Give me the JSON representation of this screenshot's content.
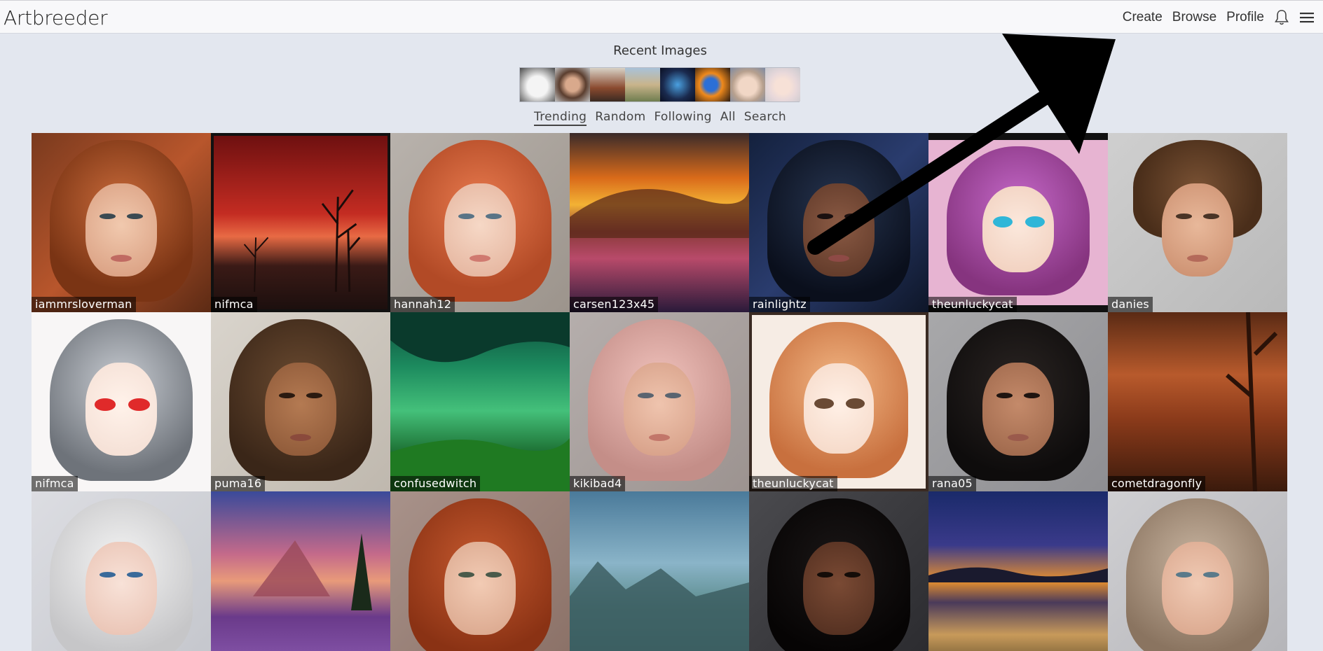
{
  "brand": "Artbreeder",
  "nav": {
    "create": "Create",
    "browse": "Browse",
    "profile": "Profile"
  },
  "recent": {
    "title": "Recent Images"
  },
  "tabs": [
    "Trending",
    "Random",
    "Following",
    "All",
    "Search"
  ],
  "grid": {
    "usernames": [
      "iammrsloverman",
      "nifmca",
      "hannah12",
      "carsen123x45",
      "rainlightz",
      "theunluckycat",
      "danies",
      "nifmca",
      "puma16",
      "confusedwitch",
      "kikibad4",
      "theunluckycat",
      "rana05",
      "cometdragonfly"
    ]
  },
  "colors": {
    "background": "#e3e7ef",
    "topbar": "#f8f8fa",
    "annotation_arrow": "#000000"
  }
}
